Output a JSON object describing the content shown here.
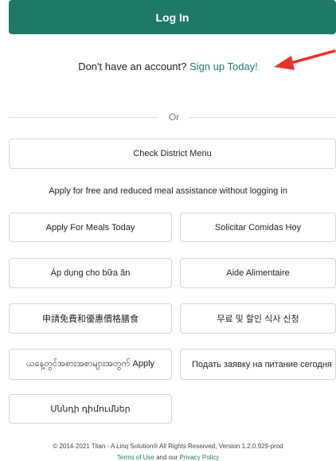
{
  "login": {
    "label": "Log In"
  },
  "signup": {
    "prompt": "Don't have an account?",
    "link": "Sign up Today!"
  },
  "divider": {
    "or": "Or"
  },
  "district_menu": {
    "label": "Check District Menu"
  },
  "apply_note": "Apply for free and reduced meal assistance without logging in",
  "apply_buttons": [
    {
      "label": "Apply For Meals Today"
    },
    {
      "label": "Solicitar Comidas Hoy"
    },
    {
      "label": "Áp dụng cho bữa ăn"
    },
    {
      "label": "Aide Alimentaire"
    },
    {
      "label": "申請免費和優惠價格膳食"
    },
    {
      "label": "무료 및 할인 식사 신청"
    },
    {
      "label": "ယနေ့တွင်အစားအစာများအတွက် Apply"
    },
    {
      "label": "Подать заявку на питание сегодня"
    },
    {
      "label": "Սննդի դիմումներ"
    }
  ],
  "footer": {
    "copyright": "© 2014-2021 Titan - A Linq Solution® All Rights Reserved, Version 1.2.0.929-prod",
    "terms": "Terms of Use",
    "and_our": " and our ",
    "privacy": "Privacy Policy"
  },
  "colors": {
    "accent": "#1e7a66",
    "annotation_arrow": "#e8322a"
  }
}
